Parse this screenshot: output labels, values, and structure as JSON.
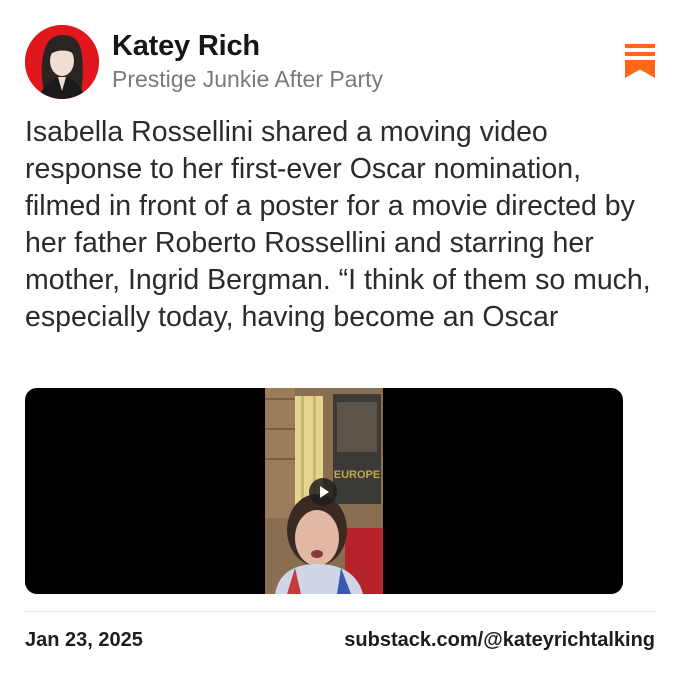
{
  "author": {
    "name": "Katey Rich",
    "publication": "Prestige Junkie After Party",
    "avatar_bg": "#e0181d"
  },
  "bookmark_icon": "substack-bookmark-icon",
  "accent_color": "#ff6719",
  "post": {
    "text": "Isabella Rossellini shared a moving video response to her first-ever Oscar nomination, filmed in front of a poster for a movie directed by her father Roberto Rossellini and starring her mother, Ingrid Bergman. “I think of them so much, especially today, having become an Oscar"
  },
  "video": {
    "poster_text": "EUROPE",
    "play_icon": "play-icon"
  },
  "footer": {
    "date": "Jan 23, 2025",
    "source": "substack.com/@kateyrichtalking"
  }
}
